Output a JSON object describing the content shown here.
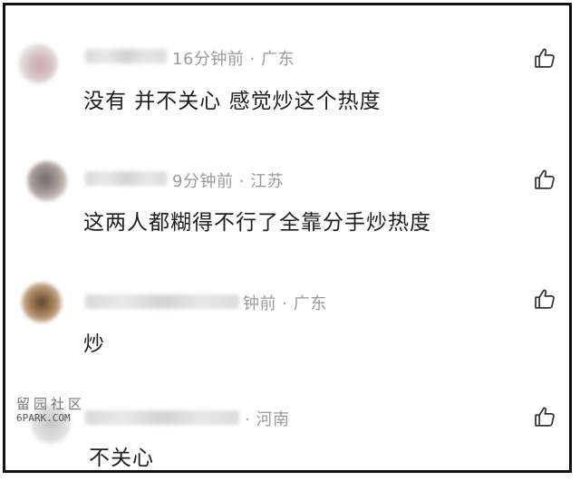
{
  "comments": [
    {
      "time": "16分钟前",
      "separator": "·",
      "location": "广东",
      "text": "没有 并不关心 感觉炒这个热度"
    },
    {
      "time": "9分钟前",
      "separator": "·",
      "location": "江苏",
      "text": "这两人都糊得不行了全靠分手炒热度"
    },
    {
      "time": "钟前",
      "separator": "·",
      "location": "广东",
      "text": "炒"
    },
    {
      "time": "",
      "separator": "·",
      "location": "河南",
      "text": "不关心"
    }
  ],
  "watermark": {
    "line1": "留园社区",
    "line2": "6PARK.COM"
  },
  "colors": {
    "text": "#1e1e1e",
    "meta": "#9a9a9a",
    "like_icon": "#333333"
  },
  "icons": {
    "like": "thumbs-up-icon"
  }
}
